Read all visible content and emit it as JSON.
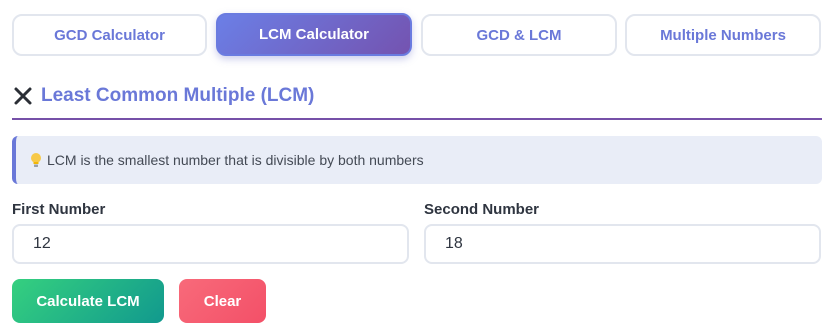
{
  "tabs": [
    {
      "label": "GCD Calculator",
      "active": false
    },
    {
      "label": "LCM Calculator",
      "active": true
    },
    {
      "label": "GCD & LCM",
      "active": false
    },
    {
      "label": "Multiple Numbers",
      "active": false
    }
  ],
  "section": {
    "icon": "close-x-icon",
    "title": "Least Common Multiple (LCM)"
  },
  "info": {
    "icon": "lightbulb-icon",
    "text": "LCM is the smallest number that is divisible by both numbers"
  },
  "fields": {
    "first_label": "First Number",
    "first_value": "12",
    "second_label": "Second Number",
    "second_value": "18"
  },
  "buttons": {
    "calculate_label": "Calculate LCM",
    "clear_label": "Clear"
  },
  "colors": {
    "accent": "#6a78d8",
    "accent_dark": "#7650a8",
    "success": "#11998e",
    "danger": "#f35068"
  }
}
